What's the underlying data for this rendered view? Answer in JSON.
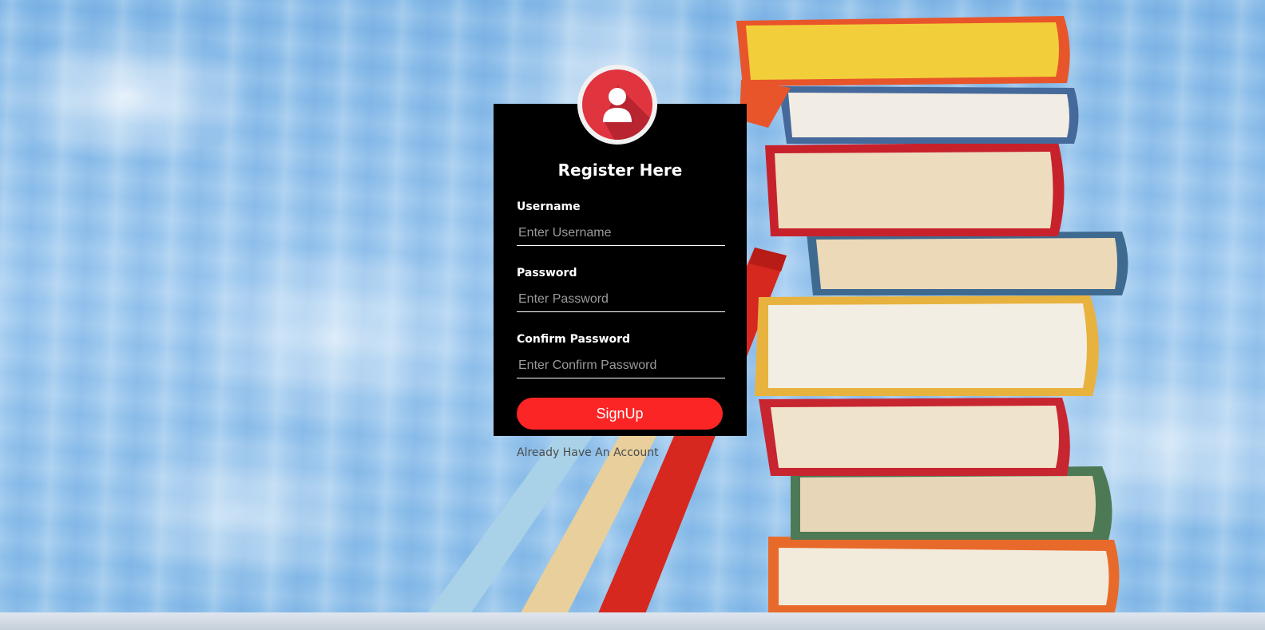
{
  "form": {
    "title": "Register Here",
    "fields": [
      {
        "label": "Username",
        "placeholder": "Enter Username",
        "value": ""
      },
      {
        "label": "Password",
        "placeholder": "Enter Password",
        "value": ""
      },
      {
        "label": "Confirm Password",
        "placeholder": "Enter Confirm Password",
        "value": ""
      }
    ],
    "submit_label": "SignUp",
    "login_link": "Already Have An Account"
  },
  "avatar": {
    "icon": "user-icon"
  },
  "background": {
    "description_icon": "stacked-books-image"
  },
  "colors": {
    "card_bg": "#000000",
    "accent": "#fb2525",
    "avatar_red": "#e0343f",
    "page_blue": "#8fc0ec"
  }
}
